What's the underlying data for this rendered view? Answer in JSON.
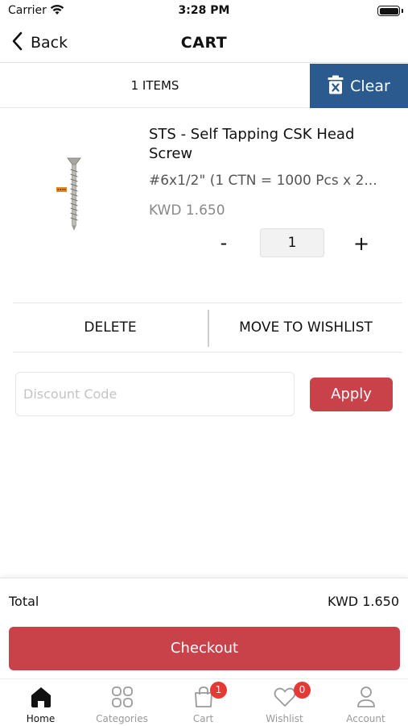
{
  "status_bar": {
    "carrier": "Carrier",
    "time": "3:28 PM"
  },
  "nav": {
    "back_label": "Back",
    "title": "CART"
  },
  "cart_header": {
    "items_count": "1 ITEMS",
    "clear_label": "Clear",
    "clear_color": "#2a5a8e"
  },
  "items": [
    {
      "name": "STS - Self Tapping CSK Head Screw",
      "variant": "#6x1/2\" (1 CTN = 1000 Pcs x 2...",
      "price": "KWD 1.650",
      "quantity": "1",
      "minus_label": "-",
      "plus_label": "+",
      "image_icon": "screw-product-image"
    }
  ],
  "actions": {
    "delete_label": "DELETE",
    "wishlist_label": "MOVE TO WISHLIST"
  },
  "discount": {
    "placeholder": "Discount Code",
    "value": "",
    "apply_label": "Apply"
  },
  "summary": {
    "total_label": "Total",
    "total_value": "KWD 1.650",
    "checkout_label": "Checkout"
  },
  "theme": {
    "accent": "#c9424a",
    "badge": "#e53935"
  },
  "tabs": [
    {
      "label": "Home",
      "icon": "home-icon",
      "active": true
    },
    {
      "label": "Categories",
      "icon": "categories-icon",
      "active": false
    },
    {
      "label": "Cart",
      "icon": "cart-icon",
      "active": false,
      "badge": "1"
    },
    {
      "label": "Wishlist",
      "icon": "heart-icon",
      "active": false,
      "badge": "0"
    },
    {
      "label": "Account",
      "icon": "account-icon",
      "active": false
    }
  ]
}
